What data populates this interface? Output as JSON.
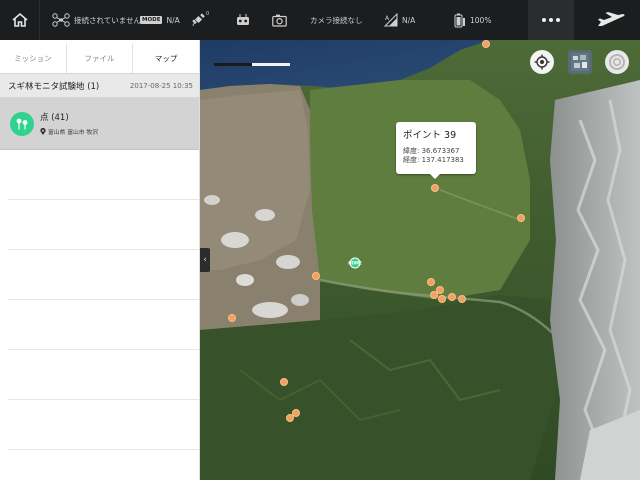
{
  "topbar": {
    "connection_text": "接続されていません",
    "mode_badge": "MODE",
    "mode_value": "N/A",
    "sat_count": "0",
    "camera_text": "カメラ接続なし",
    "signal_value": "N/A",
    "battery_value": "100%"
  },
  "tabs": [
    {
      "label": "ミッション"
    },
    {
      "label": "ファイル"
    },
    {
      "label": "マップ"
    }
  ],
  "mission": {
    "title": "スギ林モニタ試験地 (1)",
    "date": "2017-08-25 10:35"
  },
  "point_group": {
    "name": "点 (41)",
    "location": "富山県 富山市 牧沢"
  },
  "tooltip": {
    "title": "ポイント 39",
    "lat_line": "緯度: 36.673367",
    "lon_line": "経度: 137.417383"
  },
  "home_marker": "HOME",
  "colors": {
    "accent_green": "#2fd38e",
    "waypoint_orange": "#f3a05d",
    "topbar_bg": "#1b1d1f"
  }
}
